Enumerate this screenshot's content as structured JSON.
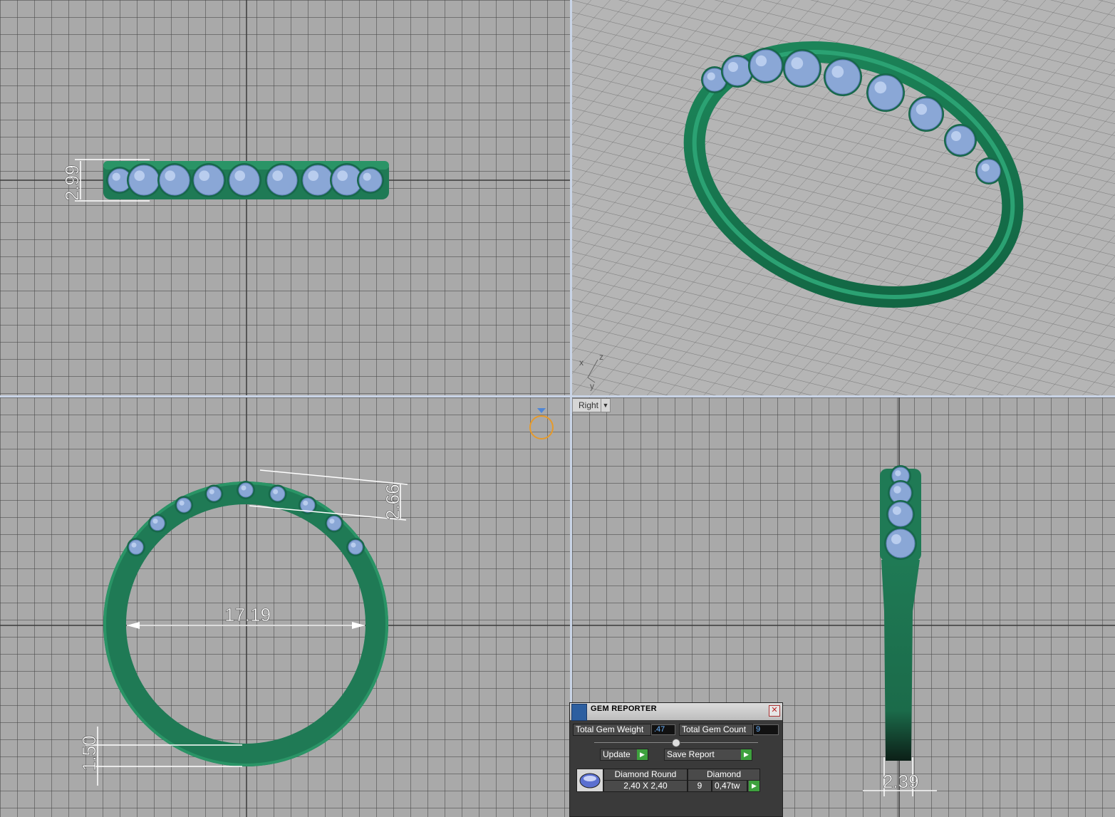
{
  "viewports": {
    "top": {
      "dimension": "2.99"
    },
    "front": {
      "dim_height": "2.66",
      "dim_inner": "17.19",
      "dim_shank": "1.50"
    },
    "right": {
      "label": "Right",
      "dim_width": "2.39"
    },
    "perspective": {
      "axes": {
        "x": "x",
        "y": "y",
        "z": "z"
      }
    }
  },
  "colors": {
    "metal": "#1f7a55",
    "gem": "#8aa7d6",
    "dimension": "#ffffff",
    "grid": "#a9a9a9"
  },
  "gem_reporter": {
    "title": "GEM REPORTER",
    "total_weight_label": "Total Gem Weight",
    "total_weight_value": ".47",
    "total_count_label": "Total Gem Count",
    "total_count_value": "9",
    "update_label": "Update",
    "save_label": "Save Report",
    "table": {
      "col1_header": "Diamond Round",
      "col2_header": "Diamond",
      "size": "2,40 X 2,40",
      "count": "9",
      "weight": "0,47tw"
    }
  }
}
